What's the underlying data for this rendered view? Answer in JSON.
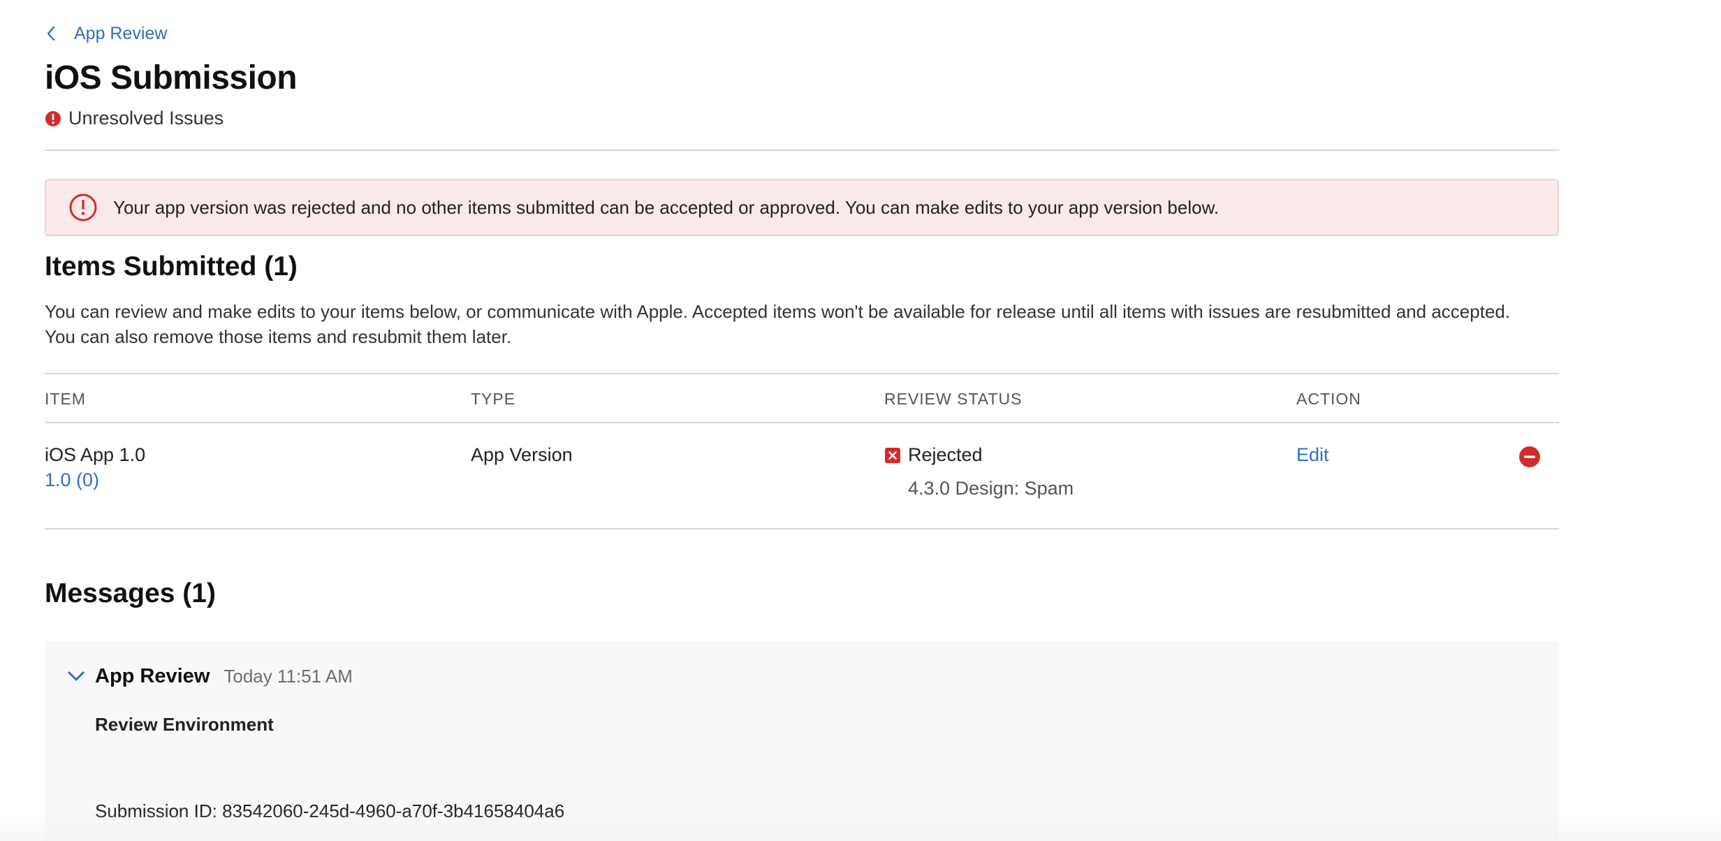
{
  "breadcrumb": {
    "label": "App Review",
    "icon": "chevron-left-icon"
  },
  "page": {
    "title": "iOS Submission",
    "status": "Unresolved Issues",
    "status_icon": "error-circle-icon"
  },
  "alert": {
    "icon": "exclamation-circle-icon",
    "text": "Your app version was rejected and no other items submitted can be accepted or approved. You can make edits to your app version below."
  },
  "items_section": {
    "title": "Items Submitted (1)",
    "description": "You can review and make edits to your items below, or communicate with Apple. Accepted items won't be available for release until all items with issues are resubmitted and accepted. You can also remove those items and resubmit them later.",
    "columns": [
      "ITEM",
      "TYPE",
      "REVIEW STATUS",
      "ACTION"
    ],
    "rows": [
      {
        "item": "iOS App 1.0",
        "build": "1.0 (0)",
        "type": "App Version",
        "status": "Rejected",
        "status_icon": "x-square-icon",
        "reason": "4.3.0 Design: Spam",
        "action": "Edit",
        "remove_icon": "minus-circle-icon"
      }
    ]
  },
  "messages_section": {
    "title": "Messages (1)",
    "messages": [
      {
        "sender": "App Review",
        "time": "Today 11:51 AM",
        "subheading": "Review Environment",
        "body": "Submission ID: 83542060-245d-4960-a70f-3b41658404a6",
        "toggle_icon": "chevron-down-icon"
      }
    ]
  },
  "colors": {
    "link": "#2f6fbe",
    "error": "#d12c2c",
    "alert_bg": "#f9e9e9",
    "divider": "#d6d6d6"
  }
}
